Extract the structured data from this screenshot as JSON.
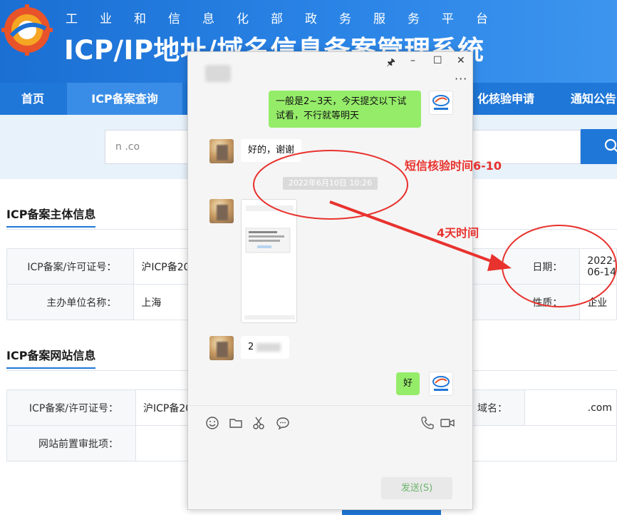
{
  "header": {
    "subtitle": "工业和信息化部政务服务平台",
    "title": "ICP/IP地址/域名信息备案管理系统"
  },
  "nav": {
    "items": [
      {
        "label": "首页"
      },
      {
        "label": "ICP备案查询"
      },
      {
        "label": "化核验申请"
      },
      {
        "label": "通知公告"
      }
    ]
  },
  "search": {
    "value": "n                   .co"
  },
  "sections": {
    "subject": {
      "title": "ICP备案主体信息",
      "rows": [
        {
          "label": "ICP备案/许可证号：",
          "value": "沪ICP备20",
          "label2": "日期：",
          "value2": "2022-06-14"
        },
        {
          "label": "主办单位名称：",
          "value": "上海",
          "label2": "性质：",
          "value2": "企业"
        }
      ]
    },
    "website": {
      "title": "ICP备案网站信息",
      "rows": [
        {
          "label": "ICP备案/许可证号：",
          "value": "沪ICP备20",
          "label2": "域名：",
          "value2": ".com"
        },
        {
          "label": "网站前置审批项：",
          "value": "",
          "label2": "",
          "value2": ""
        }
      ]
    }
  },
  "chat": {
    "window_controls": {
      "pin": "🖈",
      "minimize": "–",
      "maximize": "☐",
      "close": "✕"
    },
    "more": "···",
    "messages": {
      "msg1": "一般是2~3天，今天提交以下试试看，不行就等明天",
      "msg2": "好的，谢谢",
      "timestamp": "2022年6月10日 10:26",
      "msg3": "2",
      "msg4": "好"
    },
    "toolbar": [
      "emoji-icon",
      "folder-icon",
      "scissors-icon",
      "chat-bubble-icon",
      "phone-icon",
      "video-icon"
    ],
    "send_label": "发送(S)"
  },
  "annotations": {
    "sms_label": "短信核验时间6-10",
    "days_label": "4天时间",
    "color": "#e8322e"
  }
}
